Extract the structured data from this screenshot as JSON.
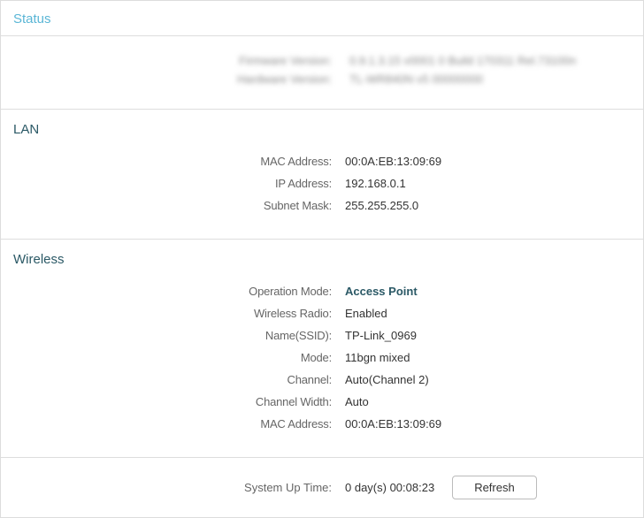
{
  "header": {
    "title": "Status"
  },
  "blurred": {
    "row1_label": "Firmware Version:",
    "row1_value": "0.9.1.3.15 v0001 0 Build 170311 Rel.73100n",
    "row2_label": "Hardware Version:",
    "row2_value": "TL-WR840N v5 00000000"
  },
  "lan": {
    "title": "LAN",
    "mac_address_label": "MAC Address:",
    "mac_address": "00:0A:EB:13:09:69",
    "ip_address_label": "IP Address:",
    "ip_address": "192.168.0.1",
    "subnet_mask_label": "Subnet Mask:",
    "subnet_mask": "255.255.255.0"
  },
  "wireless": {
    "title": "Wireless",
    "operation_mode_label": "Operation Mode:",
    "operation_mode": "Access Point",
    "wireless_radio_label": "Wireless Radio:",
    "wireless_radio": "Enabled",
    "name_ssid_label": "Name(SSID):",
    "name_ssid": "TP-Link_0969",
    "mode_label": "Mode:",
    "mode": "11bgn mixed",
    "channel_label": "Channel:",
    "channel": "Auto(Channel 2)",
    "channel_width_label": "Channel Width:",
    "channel_width": "Auto",
    "mac_address_label": "MAC Address:",
    "mac_address": "00:0A:EB:13:09:69"
  },
  "uptime": {
    "label": "System Up Time:",
    "value": "0 day(s) 00:08:23",
    "refresh_label": "Refresh"
  }
}
